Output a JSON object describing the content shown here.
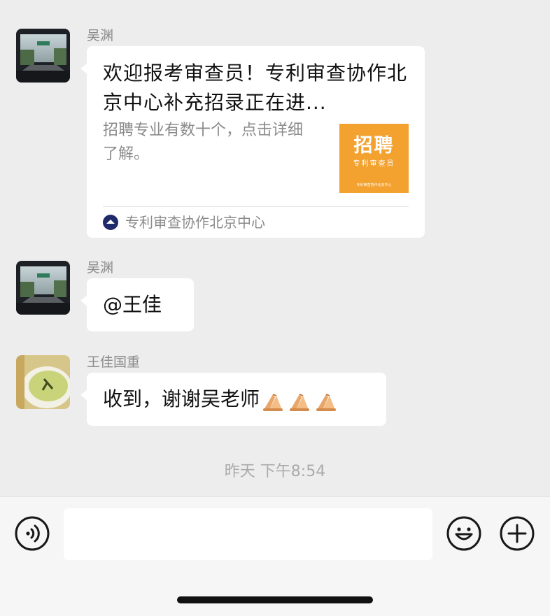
{
  "messages": [
    {
      "sender": "吴渊",
      "card": {
        "title": "欢迎报考审查员！专利审查协作北京中心补充招录正在进...",
        "description": "招聘专业有数十个，点击详细了解。",
        "thumbnail": {
          "headline": "招聘",
          "subtitle": "专利审查员",
          "footer": "专利审查协作北京中心"
        },
        "source": "专利审查协作北京中心"
      }
    },
    {
      "sender": "吴渊",
      "text": "@王佳"
    },
    {
      "sender": "王佳国重",
      "text": "收到，谢谢吴老师",
      "emoji": [
        "folded-hands",
        "folded-hands",
        "folded-hands"
      ]
    }
  ],
  "timestamp": "昨天 下午8:54",
  "input": {
    "value": "",
    "icons": {
      "voice": "voice-icon",
      "emoji": "smiley-icon",
      "more": "plus-icon"
    }
  },
  "colors": {
    "background": "#ededed",
    "bubble": "#ffffff",
    "thumbnail": "#f3a12f",
    "meta_text": "#8b8b8b"
  }
}
